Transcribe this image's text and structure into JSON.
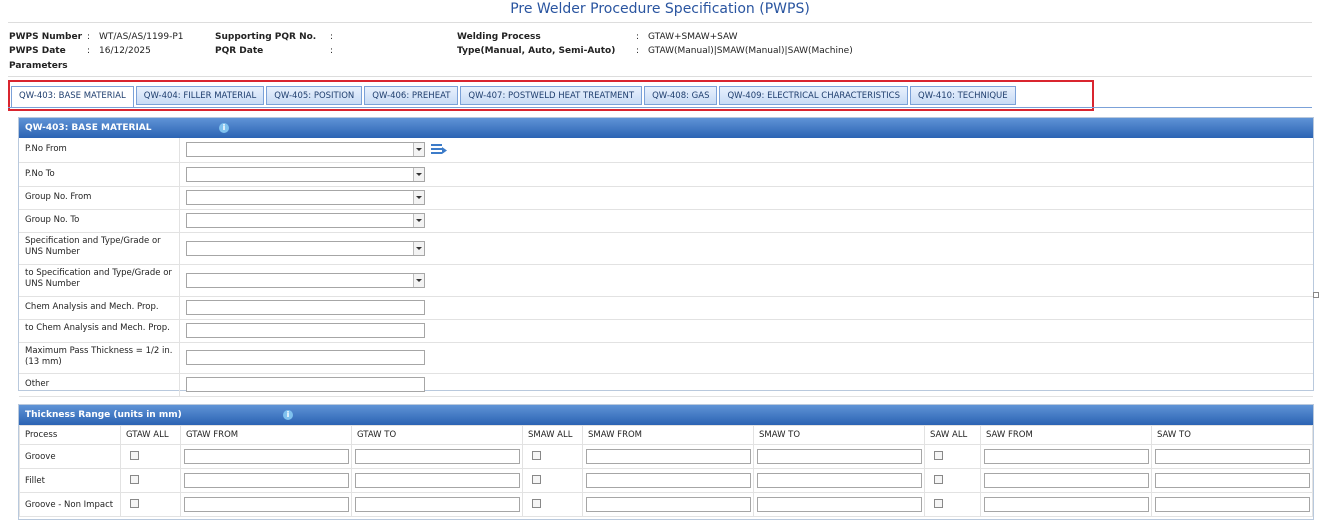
{
  "page_title": "Pre Welder Procedure Specification (PWPS)",
  "header": {
    "pwps_number_label": "PWPS Number",
    "pwps_number_value": "WT/AS/AS/1199-P1",
    "pwps_date_label": "PWPS Date",
    "pwps_date_value": "16/12/2025",
    "parameters_label": "Parameters",
    "pqr_no_label": "Supporting PQR No.",
    "pqr_no_value": "",
    "pqr_date_label": "PQR Date",
    "pqr_date_value": "",
    "welding_process_label": "Welding Process",
    "welding_process_value": "GTAW+SMAW+SAW",
    "type_label": "Type(Manual, Auto, Semi-Auto)",
    "type_value": "GTAW(Manual)|SMAW(Manual)|SAW(Machine)",
    "colon": ":"
  },
  "tabs": [
    {
      "label": "QW-403: BASE MATERIAL",
      "active": true
    },
    {
      "label": "QW-404: FILLER MATERIAL",
      "active": false
    },
    {
      "label": "QW-405: POSITION",
      "active": false
    },
    {
      "label": "QW-406: PREHEAT",
      "active": false
    },
    {
      "label": "QW-407: POSTWELD HEAT TREATMENT",
      "active": false
    },
    {
      "label": "QW-408: GAS",
      "active": false
    },
    {
      "label": "QW-409: ELECTRICAL CHARACTERISTICS",
      "active": false
    },
    {
      "label": "QW-410: TECHNIQUE",
      "active": false
    }
  ],
  "base_material": {
    "title": "QW-403: BASE MATERIAL",
    "fields": [
      {
        "label": "P.No From",
        "type": "select",
        "value": ""
      },
      {
        "label": "P.No To",
        "type": "select",
        "value": ""
      },
      {
        "label": "Group No. From",
        "type": "select",
        "value": ""
      },
      {
        "label": "Group No. To",
        "type": "select",
        "value": ""
      },
      {
        "label": "Specification and Type/Grade or UNS Number",
        "type": "select",
        "value": ""
      },
      {
        "label": "to Specification and Type/Grade or UNS Number",
        "type": "select",
        "value": ""
      },
      {
        "label": "Chem Analysis and Mech. Prop.",
        "type": "text",
        "value": ""
      },
      {
        "label": "to Chem Analysis and Mech. Prop.",
        "type": "text",
        "value": ""
      },
      {
        "label": "Maximum Pass Thickness = 1/2 in. (13 mm)",
        "type": "text",
        "value": ""
      },
      {
        "label": "Other",
        "type": "text",
        "value": ""
      }
    ]
  },
  "thickness": {
    "title": "Thickness Range (units in mm)",
    "columns": [
      "Process",
      "GTAW ALL",
      "GTAW FROM",
      "GTAW TO",
      "SMAW ALL",
      "SMAW FROM",
      "SMAW TO",
      "SAW ALL",
      "SAW FROM",
      "SAW TO"
    ],
    "rows": [
      {
        "process": "Groove"
      },
      {
        "process": "Fillet"
      },
      {
        "process": "Groove - Non Impact"
      }
    ]
  },
  "colors": {
    "accent": "#2b63b3",
    "title": "#2a55a0",
    "highlight": "#d9252f"
  }
}
